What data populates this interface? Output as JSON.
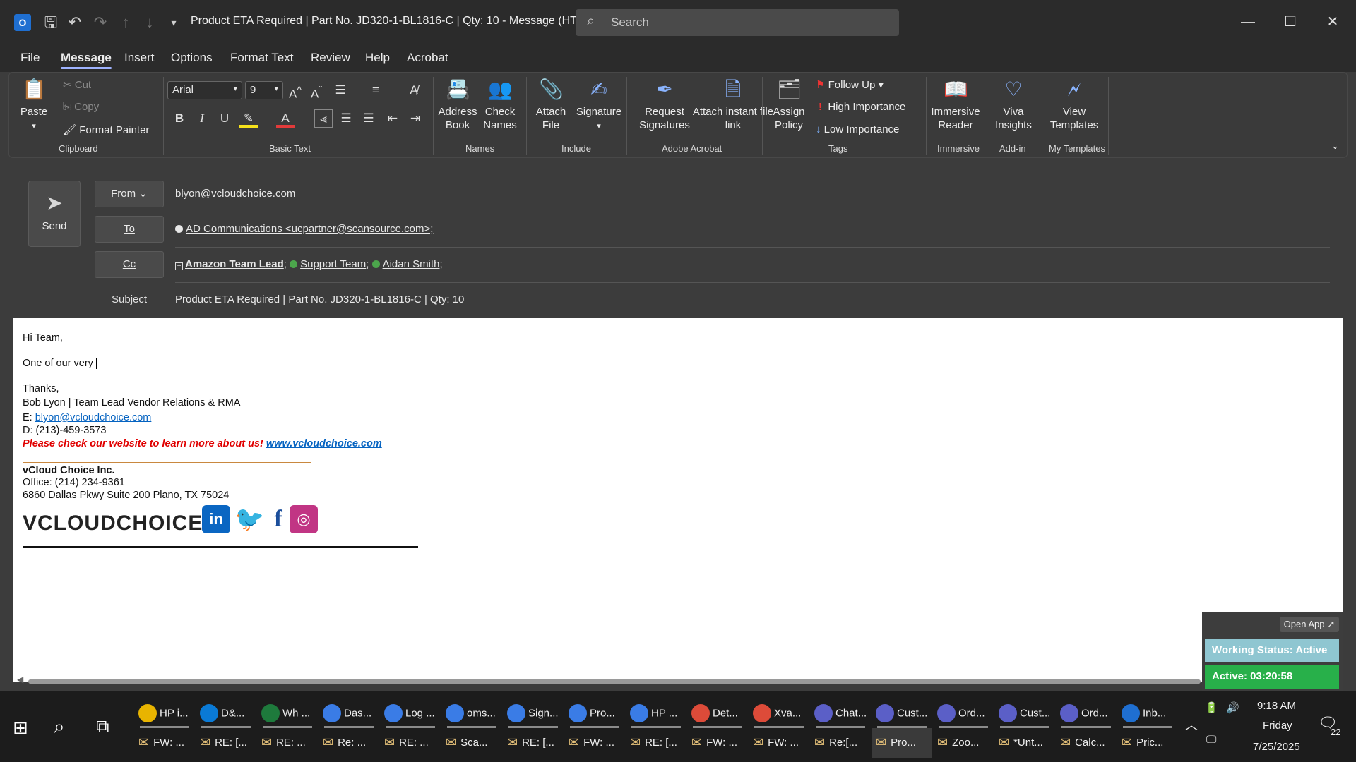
{
  "titlebar": {
    "app_icon": "O",
    "window_title": "Product ETA Required | Part No. JD320-1-BL1816-C | Qty: 10  -  Message (HT...",
    "search_placeholder": "Search"
  },
  "menu": {
    "tabs": [
      "File",
      "Message",
      "Insert",
      "Options",
      "Format Text",
      "Review",
      "Help",
      "Acrobat"
    ],
    "active": "Message"
  },
  "ribbon": {
    "clipboard": {
      "label": "Clipboard",
      "paste": "Paste",
      "cut": "Cut",
      "copy": "Copy",
      "format_painter": "Format Painter"
    },
    "basic_text": {
      "label": "Basic Text",
      "font": "Arial",
      "size": "9"
    },
    "names": {
      "label": "Names",
      "address_book": "Address Book",
      "check_names": "Check Names"
    },
    "include": {
      "label": "Include",
      "attach_file": "Attach File",
      "signature": "Signature"
    },
    "adobe": {
      "label": "Adobe Acrobat",
      "request_signatures": "Request Signatures",
      "attach_instant": "Attach instant file link"
    },
    "tags": {
      "label": "Tags",
      "assign_policy": "Assign Policy",
      "follow_up": "Follow Up",
      "high_importance": "High Importance",
      "low_importance": "Low Importance"
    },
    "immersive": {
      "label": "Immersive",
      "reader": "Immersive Reader"
    },
    "addin": {
      "label": "Add-in",
      "viva": "Viva Insights"
    },
    "templates": {
      "label": "My Templates",
      "view": "View Templates"
    }
  },
  "header": {
    "send": "Send",
    "from_label": "From",
    "from_value": "blyon@vcloudchoice.com",
    "to_label": "To",
    "to_value": "AD Communications <ucpartner@scansource.com>;",
    "cc_label": "Cc",
    "cc": [
      "Amazon Team Lead",
      "Support Team",
      "Aidan Smith"
    ],
    "subject_label": "Subject",
    "subject_value": "Product ETA Required | Part No. JD320-1-BL1816-C | Qty: 10"
  },
  "body": {
    "greeting": "Hi Team,",
    "line1": "One of our very ",
    "thanks": "Thanks,",
    "signature_name": "Bob Lyon | Team Lead Vendor Relations & RMA",
    "email_prefix": "E: ",
    "email": "blyon@vcloudchoice.com",
    "phone": "D: (213)-459-3573",
    "promo": "Please check our website to learn more about us! ",
    "website": "www.vcloudchoice.com",
    "company": "vCloud Choice Inc.",
    "office": "Office: (214) 234-9361",
    "address": "6860 Dallas Pkwy Suite 200 Plano, TX 75024",
    "logo_text": "VCLOUDCHOICE"
  },
  "widget": {
    "open_app": "Open App ↗",
    "working_status": "Working Status: Active",
    "active_timer": "Active: 03:20:58"
  },
  "taskbar": {
    "row1": [
      {
        "label": "HP i...",
        "color": "#e8b400"
      },
      {
        "label": "D&...",
        "color": "#0a7ad6"
      },
      {
        "label": "Wh ...",
        "color": "#1e7a3c"
      },
      {
        "label": "Das...",
        "color": "#3a7ce6"
      },
      {
        "label": "Log ...",
        "color": "#3a7ce6"
      },
      {
        "label": "oms...",
        "color": "#3a7ce6"
      },
      {
        "label": "Sign...",
        "color": "#3a7ce6"
      },
      {
        "label": "Pro...",
        "color": "#3a7ce6"
      },
      {
        "label": "HP ...",
        "color": "#3a7ce6"
      },
      {
        "label": "Det...",
        "color": "#dd4b39"
      },
      {
        "label": "Xva...",
        "color": "#dd4b39"
      },
      {
        "label": "Chat...",
        "color": "#5b5fc7"
      },
      {
        "label": "Cust...",
        "color": "#5b5fc7"
      },
      {
        "label": "Ord...",
        "color": "#5b5fc7"
      },
      {
        "label": "Cust...",
        "color": "#5b5fc7"
      },
      {
        "label": "Ord...",
        "color": "#5b5fc7"
      },
      {
        "label": "Inb...",
        "color": "#1f6fd1"
      }
    ],
    "row2": [
      "FW: ...",
      "RE: [...",
      "RE: ...",
      "Re: ...",
      "RE: ...",
      "Sca...",
      "RE: [...",
      "FW: ...",
      "RE: [...",
      "FW: ...",
      "FW: ...",
      "Re:[...",
      "Pro...",
      "Zoo...",
      "*Unt...",
      "Calc...",
      "Pric..."
    ],
    "time": "9:18 AM",
    "day": "Friday",
    "date": "7/25/2025",
    "notif_count": "22"
  }
}
